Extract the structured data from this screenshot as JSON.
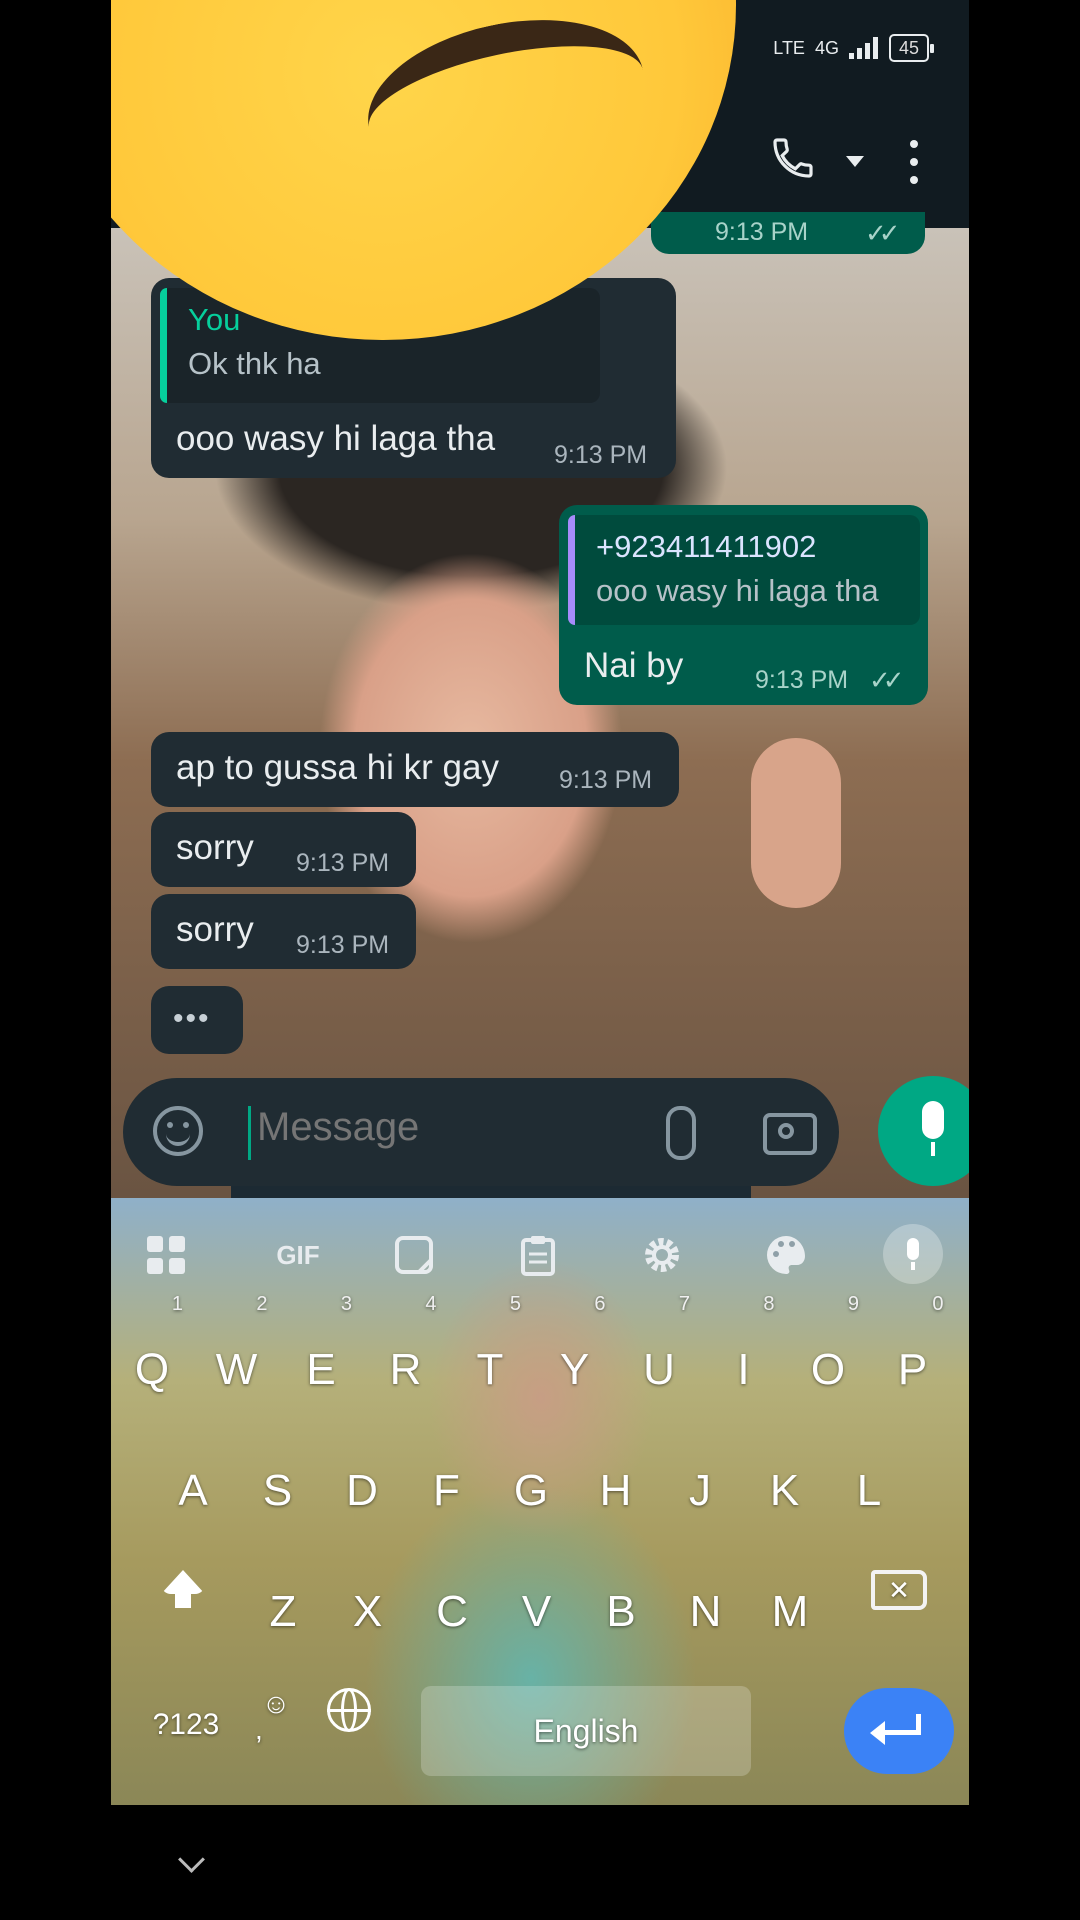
{
  "status_bar": {
    "network": "4G",
    "lte": "LTE",
    "battery": "45"
  },
  "messages": [
    {
      "kind": "incoming",
      "quote_author": "You",
      "quote_text": "Ok thk ha",
      "text": "ooo wasy hi laga tha",
      "time": "9:13 PM"
    },
    {
      "kind": "outgoing",
      "quote_author": "+923411411902",
      "quote_text": "ooo wasy hi laga tha",
      "text": "Nai by",
      "time": "9:13 PM",
      "ticks": "✓✓"
    },
    {
      "kind": "incoming",
      "text": "ap to gussa hi kr gay",
      "time": "9:13 PM"
    },
    {
      "kind": "incoming",
      "text": "sorry",
      "time": "9:13 PM"
    },
    {
      "kind": "incoming",
      "text": "sorry",
      "time": "9:13 PM"
    }
  ],
  "partial_top_time": "9:13 PM",
  "typing_indicator": "•••",
  "composer": {
    "placeholder": "Message"
  },
  "keyboard": {
    "toolbar": [
      "apps-grid-icon",
      "GIF",
      "sticker-icon",
      "clipboard-icon",
      "settings-icon",
      "theme-palette-icon",
      "voice-input-icon"
    ],
    "gif_label": "GIF",
    "row1": [
      {
        "k": "Q",
        "n": "1"
      },
      {
        "k": "W",
        "n": "2"
      },
      {
        "k": "E",
        "n": "3"
      },
      {
        "k": "R",
        "n": "4"
      },
      {
        "k": "T",
        "n": "5"
      },
      {
        "k": "Y",
        "n": "6"
      },
      {
        "k": "U",
        "n": "7"
      },
      {
        "k": "I",
        "n": "8"
      },
      {
        "k": "O",
        "n": "9"
      },
      {
        "k": "P",
        "n": "0"
      }
    ],
    "row2": [
      "A",
      "S",
      "D",
      "F",
      "G",
      "H",
      "J",
      "K",
      "L"
    ],
    "row3": [
      "Z",
      "X",
      "C",
      "V",
      "B",
      "N",
      "M"
    ],
    "num_key": "?123",
    "emoji_key": "☺",
    "comma_key": ",",
    "space_label": "English"
  }
}
